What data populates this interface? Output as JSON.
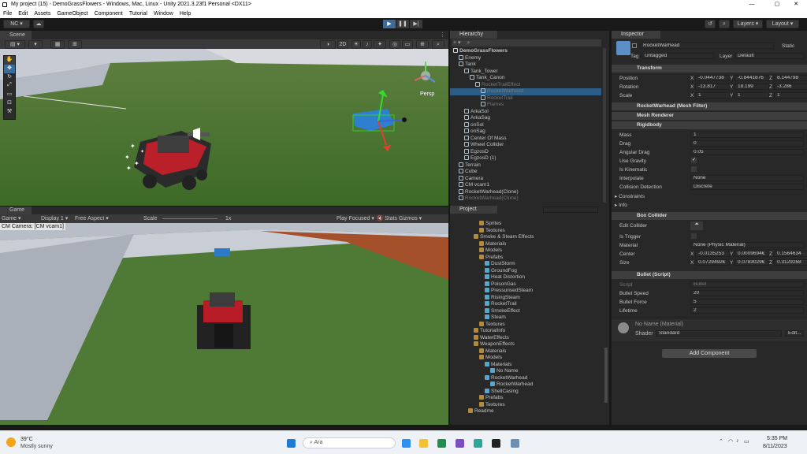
{
  "window": {
    "title": "My project (15) - DemoGrassFlowers - Windows, Mac, Linux - Unity 2021.3.23f1 Personal <DX11>"
  },
  "menu": [
    "File",
    "Edit",
    "Assets",
    "GameObject",
    "Component",
    "Tutorial",
    "Window",
    "Help"
  ],
  "toolbar": {
    "account": "NC",
    "layers": "Layers",
    "layout": "Layout"
  },
  "scene": {
    "tab": "Scene",
    "mode2d": "2D",
    "persp": "Persp"
  },
  "game": {
    "tab": "Game",
    "display_mode": "Game",
    "display": "Display 1",
    "aspect": "Free Aspect",
    "scale_label": "Scale",
    "scale_value": "1x",
    "play_focused": "Play Focused",
    "stats": "Stats",
    "gizmos": "Gizmos",
    "camera_label": "CM Camera: [CM vcam1]"
  },
  "hierarchy": {
    "tab": "Hierarchy",
    "items": [
      {
        "label": "DemoGrassFlowers",
        "depth": 0,
        "dim": false,
        "sel": false,
        "bold": true
      },
      {
        "label": "Enemy",
        "depth": 1,
        "dim": false,
        "sel": false
      },
      {
        "label": "Tank",
        "depth": 1,
        "dim": false,
        "sel": false
      },
      {
        "label": "Tank_Tower",
        "depth": 2,
        "dim": false,
        "sel": false
      },
      {
        "label": "Tank_Canon",
        "depth": 3,
        "dim": false,
        "sel": false
      },
      {
        "label": "RocketTrailEffect",
        "depth": 4,
        "dim": true,
        "sel": false
      },
      {
        "label": "RocketWarhead",
        "depth": 5,
        "dim": true,
        "sel": true
      },
      {
        "label": "RocketTrail",
        "depth": 5,
        "dim": true,
        "sel": false
      },
      {
        "label": "Flames",
        "depth": 5,
        "dim": true,
        "sel": false
      },
      {
        "label": "ArkaSol",
        "depth": 2,
        "dim": false,
        "sel": false
      },
      {
        "label": "ArkaSag",
        "depth": 2,
        "dim": false,
        "sel": false
      },
      {
        "label": "onSol",
        "depth": 2,
        "dim": false,
        "sel": false
      },
      {
        "label": "onSag",
        "depth": 2,
        "dim": false,
        "sel": false
      },
      {
        "label": "Center Of Mass",
        "depth": 2,
        "dim": false,
        "sel": false
      },
      {
        "label": "Wheel Collider",
        "depth": 2,
        "dim": false,
        "sel": false
      },
      {
        "label": "EgzosD",
        "depth": 2,
        "dim": false,
        "sel": false
      },
      {
        "label": "EgzosD (1)",
        "depth": 2,
        "dim": false,
        "sel": false
      },
      {
        "label": "Terrain",
        "depth": 1,
        "dim": false,
        "sel": false
      },
      {
        "label": "Cube",
        "depth": 1,
        "dim": false,
        "sel": false
      },
      {
        "label": "Camera",
        "depth": 1,
        "dim": false,
        "sel": false
      },
      {
        "label": "CM vcam1",
        "depth": 1,
        "dim": false,
        "sel": false
      },
      {
        "label": "RocketWarhead(Clone)",
        "depth": 1,
        "dim": false,
        "sel": false
      },
      {
        "label": "RocketWarhead(Clone)",
        "depth": 1,
        "dim": true,
        "sel": false
      }
    ]
  },
  "project": {
    "tab": "Project",
    "items": [
      {
        "label": "Sprites",
        "depth": 2
      },
      {
        "label": "Textures",
        "depth": 2
      },
      {
        "label": "Smoke & Steam Effects",
        "depth": 1
      },
      {
        "label": "Materials",
        "depth": 2
      },
      {
        "label": "Models",
        "depth": 2
      },
      {
        "label": "Prefabs",
        "depth": 2
      },
      {
        "label": "DustStorm",
        "depth": 3
      },
      {
        "label": "GroundFog",
        "depth": 3
      },
      {
        "label": "Heat Distortion",
        "depth": 3
      },
      {
        "label": "PoisonGas",
        "depth": 3
      },
      {
        "label": "PressurisedSteam",
        "depth": 3
      },
      {
        "label": "RisingSteam",
        "depth": 3
      },
      {
        "label": "RocketTrail",
        "depth": 3
      },
      {
        "label": "SmokeEffect",
        "depth": 3
      },
      {
        "label": "Steam",
        "depth": 3
      },
      {
        "label": "Textures",
        "depth": 2
      },
      {
        "label": "TutorialInfo",
        "depth": 1
      },
      {
        "label": "WaterEffects",
        "depth": 1
      },
      {
        "label": "WeaponEffects",
        "depth": 1
      },
      {
        "label": "Materials",
        "depth": 2
      },
      {
        "label": "Models",
        "depth": 2
      },
      {
        "label": "Materials",
        "depth": 3
      },
      {
        "label": "No Name",
        "depth": 4
      },
      {
        "label": "RocketWarhead",
        "depth": 3
      },
      {
        "label": "RocketWarhead",
        "depth": 4
      },
      {
        "label": "ShellCasing",
        "depth": 3
      },
      {
        "label": "Prefabs",
        "depth": 2
      },
      {
        "label": "Textures",
        "depth": 2
      },
      {
        "label": "Readme",
        "depth": 0
      }
    ]
  },
  "inspector": {
    "tab": "Inspector",
    "object_name": "RocketWarhead",
    "static": "Static",
    "tag_label": "Tag",
    "tag": "Untagged",
    "layer_label": "Layer",
    "layer": "Default",
    "transform": {
      "title": "Transform",
      "position_label": "Position",
      "position": [
        "-0.0447738",
        "-0.8441876",
        "8.144798"
      ],
      "rotation_label": "Rotation",
      "rotation": [
        "-13.817",
        "18.199",
        "-3.286"
      ],
      "scale_label": "Scale",
      "scale": [
        "1",
        "1",
        "1"
      ]
    },
    "mesh_filter": {
      "title": "RocketWarhead (Mesh Filter)"
    },
    "mesh_renderer": {
      "title": "Mesh Renderer"
    },
    "rigidbody": {
      "title": "Rigidbody",
      "mass_label": "Mass",
      "mass": "1",
      "drag_label": "Drag",
      "drag": "0",
      "angular_drag_label": "Angular Drag",
      "angular_drag": "0.05",
      "use_gravity_label": "Use Gravity",
      "use_gravity": true,
      "is_kinematic_label": "Is Kinematic",
      "is_kinematic": false,
      "interpolate_label": "Interpolate",
      "interpolate": "None",
      "collision_label": "Collision Detection",
      "collision": "Discrete",
      "constraints": "Constraints",
      "info": "Info"
    },
    "box_collider": {
      "title": "Box Collider",
      "edit_label": "Edit Collider",
      "trigger_label": "Is Trigger",
      "trigger": false,
      "material_label": "Material",
      "material": "None (Physic Material)",
      "center_label": "Center",
      "center": [
        "-0.0135253",
        "0.0009694€",
        "0.1564634"
      ],
      "size_label": "Size",
      "size": [
        "0.0729492€",
        "0.0783029€",
        "0.3129268"
      ]
    },
    "bullet": {
      "title": "Bullet (Script)",
      "script_label": "Script",
      "script": "Bullet",
      "speed_label": "Bullet Speed",
      "speed": "20",
      "force_label": "Bullet Force",
      "force": "5",
      "lifetime_label": "Lifetime",
      "lifetime": "2"
    },
    "material": {
      "name": "No Name (Material)",
      "shader_label": "Shader",
      "shader": "Standard",
      "edit": "Edit..."
    },
    "add_component": "Add Component"
  },
  "taskbar": {
    "temp": "39°C",
    "weather": "Mostly sunny",
    "search": "Ara",
    "time": "5:35 PM",
    "date": "8/11/2023"
  },
  "colors": {
    "accent_select": "#2c5d87",
    "panel": "#282828",
    "header": "#3e3e3e"
  }
}
